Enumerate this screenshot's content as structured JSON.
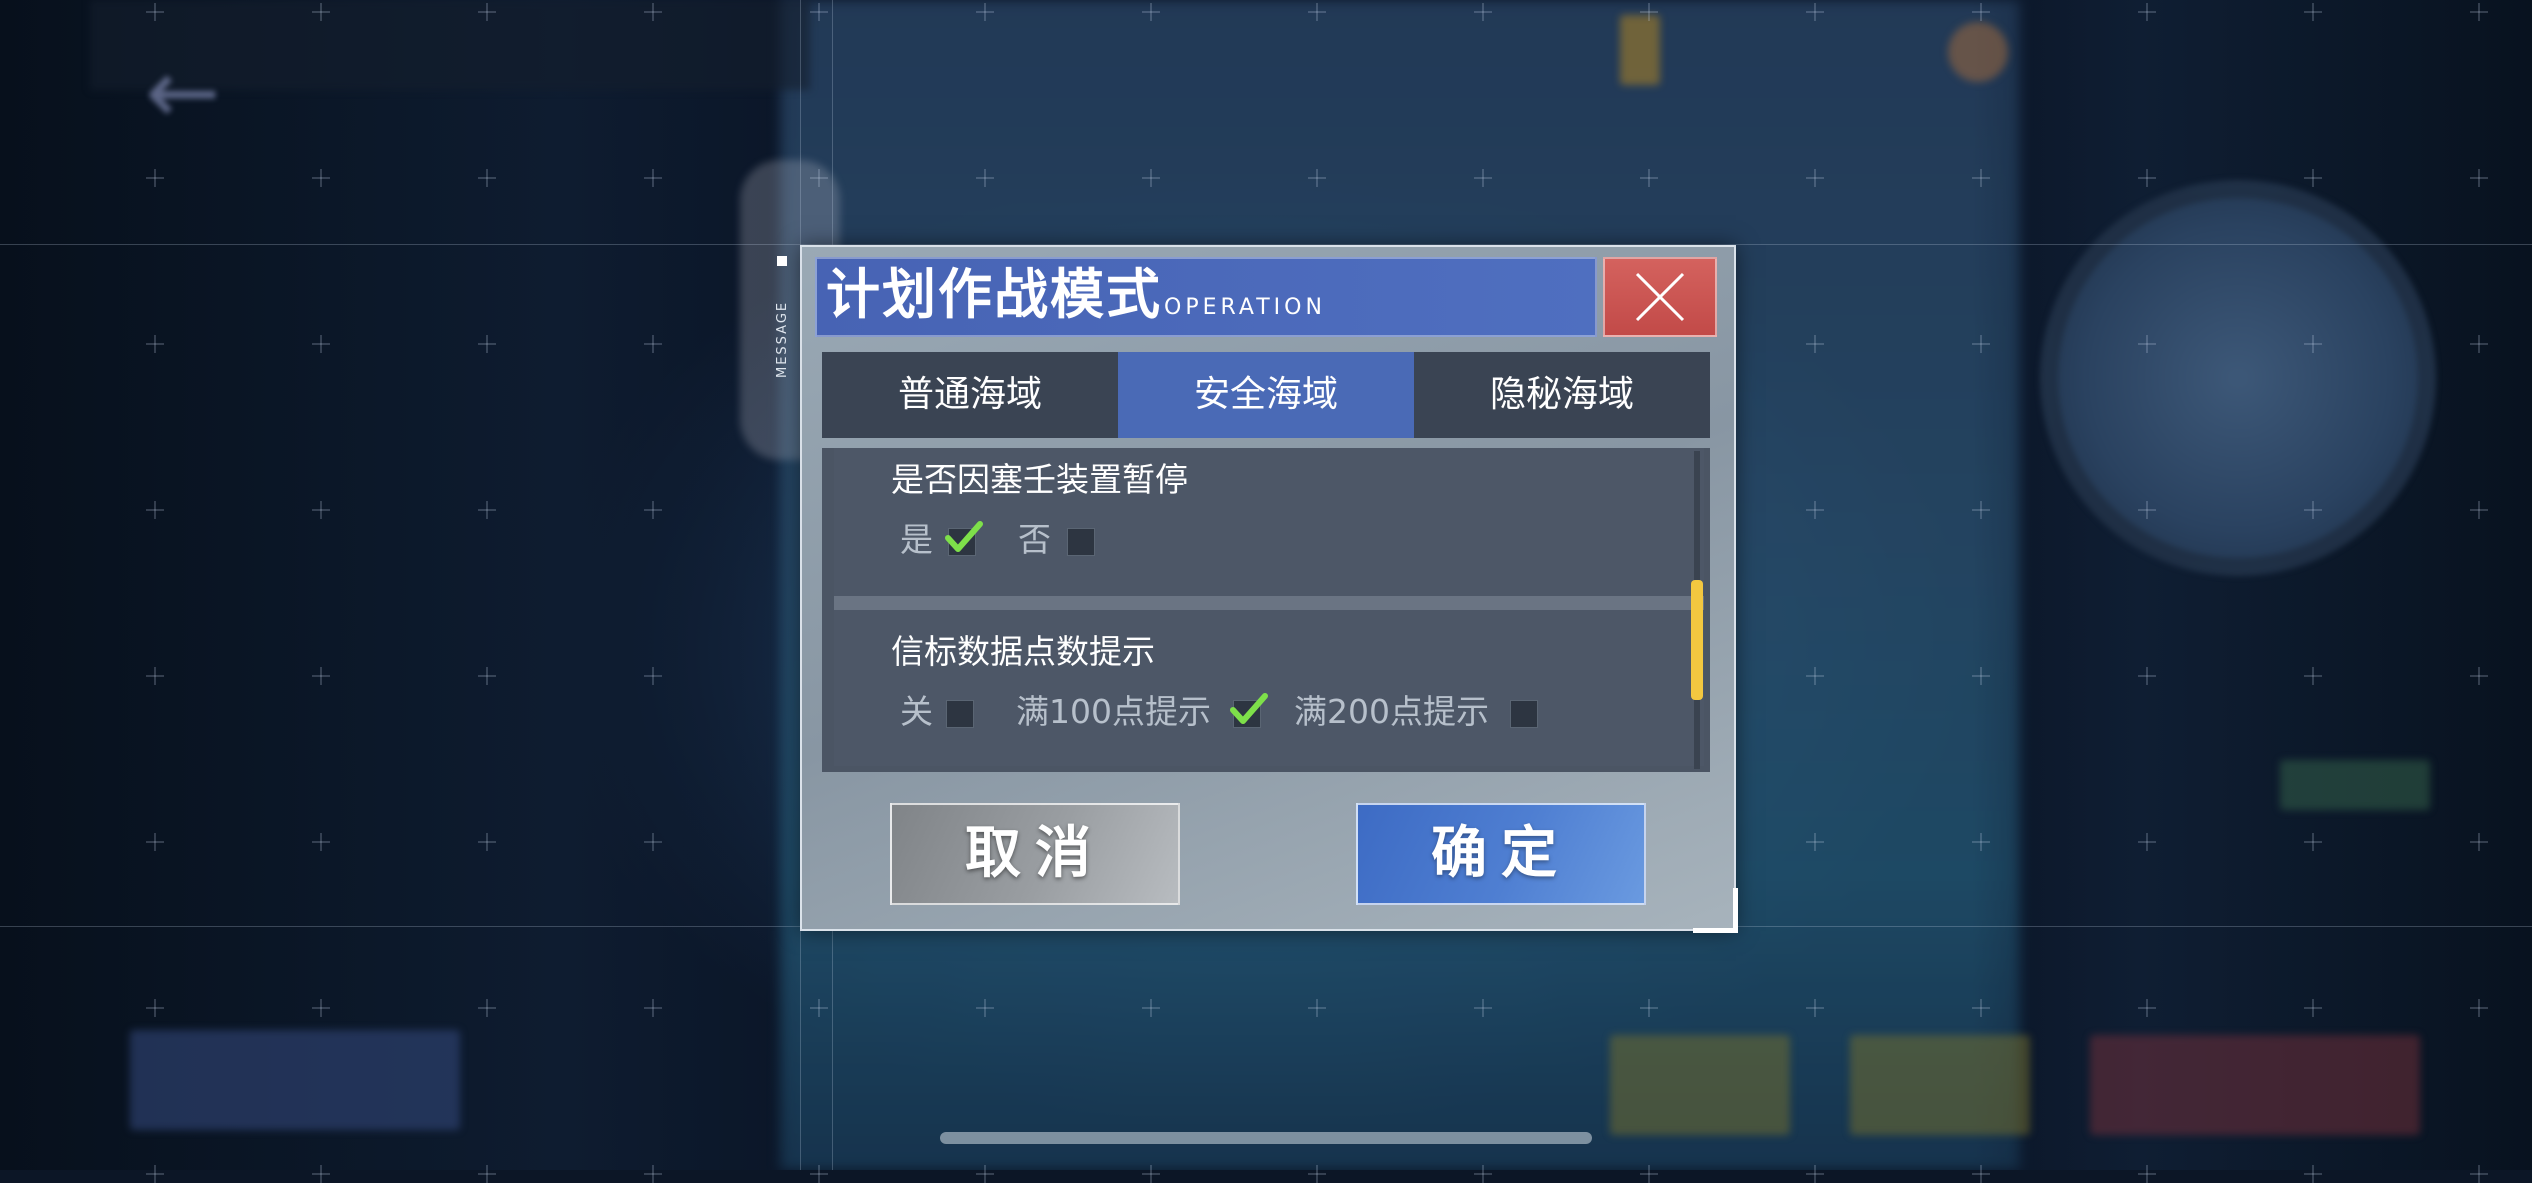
{
  "dialog": {
    "side_label": "MESSAGE",
    "title": "计划作战模式",
    "subtitle": "OPERATION",
    "close_icon": "close-icon"
  },
  "tabs": [
    {
      "label": "普通海域",
      "active": false
    },
    {
      "label": "安全海域",
      "active": true
    },
    {
      "label": "隐秘海域",
      "active": false
    }
  ],
  "settings": [
    {
      "title": "是否因塞壬装置暂停",
      "options": [
        {
          "label": "是",
          "checked": true
        },
        {
          "label": "否",
          "checked": false
        }
      ]
    },
    {
      "title": "信标数据点数提示",
      "options": [
        {
          "label": "关",
          "checked": false
        },
        {
          "label": "满100点提示",
          "checked": true
        },
        {
          "label": "满200点提示",
          "checked": false
        }
      ]
    }
  ],
  "buttons": {
    "cancel": "取消",
    "confirm": "确定"
  },
  "colors": {
    "accent": "#4a6ab6",
    "close": "#c8524f",
    "check": "#7ee04a",
    "scroll": "#f3c740"
  }
}
